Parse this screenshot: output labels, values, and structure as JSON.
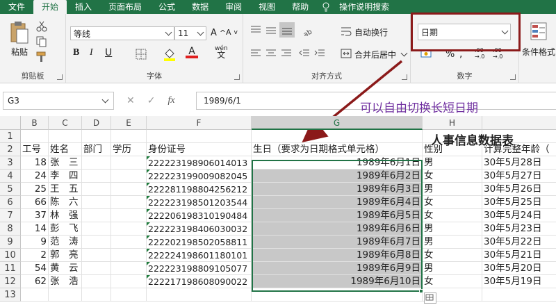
{
  "menu": {
    "tabs": [
      "文件",
      "开始",
      "插入",
      "页面布局",
      "公式",
      "数据",
      "审阅",
      "视图",
      "帮助"
    ],
    "active": "开始",
    "search": "操作说明搜索"
  },
  "ribbon": {
    "clipboard": {
      "paste_label": "粘贴",
      "group": "剪贴板"
    },
    "font": {
      "name": "等线",
      "size": "11",
      "group": "字体",
      "bold": "B",
      "italic": "I",
      "underline": "U",
      "font_a": "A",
      "wen": "wén",
      "wen_char": "文"
    },
    "alignment": {
      "wrap": "自动换行",
      "merge": "合并后居中",
      "group": "对齐方式"
    },
    "number": {
      "format": "日期",
      "percent": "%",
      "group": "数字",
      "dec_add": ".00",
      "dec_add2": "→.0",
      "dec_sub": ".00",
      "dec_sub2": "→.0"
    },
    "styles": {
      "conditional": "条件格式"
    }
  },
  "formula_bar": {
    "name_box": "G3",
    "fx": "fx",
    "formula": "1989/6/1"
  },
  "annotation": "可以自由切换长短日期",
  "grid": {
    "columns": [
      "B",
      "C",
      "D",
      "E",
      "F",
      "G",
      "H"
    ],
    "selected_column": "G",
    "title": "人事信息数据表",
    "headers": [
      "工号",
      "姓名",
      "部门",
      "学历",
      "身份证号",
      "生日（要求为日期格式单元格）",
      "性别",
      "计算完整年龄（"
    ],
    "rows": [
      [
        "18",
        "张　三",
        "",
        "",
        "222223198906014013",
        "1989年6月1日",
        "男",
        "30年5月28日"
      ],
      [
        "24",
        "李　四",
        "",
        "",
        "222223199009082045",
        "1989年6月2日",
        "女",
        "30年5月27日"
      ],
      [
        "25",
        "王　五",
        "",
        "",
        "222281198804256212",
        "1989年6月3日",
        "男",
        "30年5月26日"
      ],
      [
        "66",
        "陈　六",
        "",
        "",
        "222223198501203544",
        "1989年6月4日",
        "女",
        "30年5月25日"
      ],
      [
        "37",
        "林　强",
        "",
        "",
        "222206198310190484",
        "1989年6月5日",
        "女",
        "30年5月24日"
      ],
      [
        "14",
        "彭　飞",
        "",
        "",
        "222223198406030032",
        "1989年6月6日",
        "男",
        "30年5月23日"
      ],
      [
        "9",
        "范　涛",
        "",
        "",
        "222202198502058811",
        "1989年6月7日",
        "男",
        "30年5月22日"
      ],
      [
        "2",
        "郭　亮",
        "",
        "",
        "222224198601180101",
        "1989年6月8日",
        "女",
        "30年5月21日"
      ],
      [
        "54",
        "黄　云",
        "",
        "",
        "222223198809105077",
        "1989年6月9日",
        "男",
        "30年5月20日"
      ],
      [
        "62",
        "张　浩",
        "",
        "",
        "222217198608090022",
        "1989年6月10日",
        "女",
        "30年5月19日"
      ]
    ]
  },
  "colors": {
    "excel_green": "#217346",
    "annotation": "#7030a0",
    "highlight": "#8b1a1a",
    "selected_fill": "#c8c8c8"
  }
}
